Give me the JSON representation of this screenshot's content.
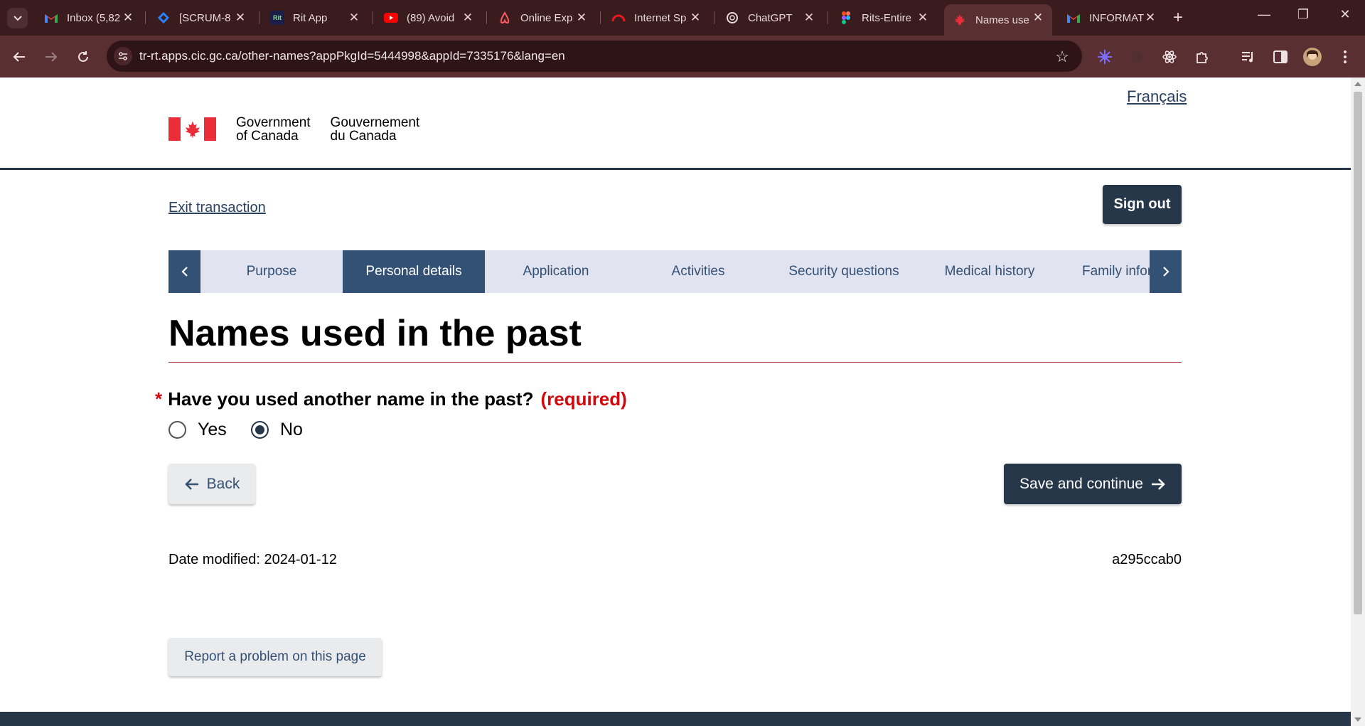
{
  "browser": {
    "tabs": [
      {
        "title": "Inbox (5,82",
        "icon": "gmail-icon"
      },
      {
        "title": "[SCRUM-8",
        "icon": "jira-icon"
      },
      {
        "title": "Rit App",
        "icon": "rit-app-icon",
        "icon_text": "Rit"
      },
      {
        "title": "(89) Avoid",
        "icon": "youtube-icon"
      },
      {
        "title": "Online Exp",
        "icon": "airbnb-icon"
      },
      {
        "title": "Internet Sp",
        "icon": "speedtest-icon"
      },
      {
        "title": "ChatGPT",
        "icon": "chatgpt-icon"
      },
      {
        "title": "Rits-Entire",
        "icon": "figma-icon"
      },
      {
        "title": "Names use",
        "icon": "maple-leaf-icon",
        "active": true
      },
      {
        "title": "INFORMAT",
        "icon": "gmail-icon"
      }
    ],
    "url": "tr-rt.apps.cic.gc.ca/other-names?appPkgId=5444998&appId=7335176&lang=en",
    "accent_color": "#5a2f32"
  },
  "header": {
    "language_link": "Français",
    "signature": {
      "en_line1": "Government",
      "en_line2": "of Canada",
      "fr_line1": "Gouvernement",
      "fr_line2": "du Canada"
    }
  },
  "nav": {
    "exit_link": "Exit transaction",
    "sign_out": "Sign out"
  },
  "steps": [
    {
      "label": "Purpose",
      "active": false
    },
    {
      "label": "Personal details",
      "active": true
    },
    {
      "label": "Application",
      "active": false
    },
    {
      "label": "Activities",
      "active": false
    },
    {
      "label": "Security questions",
      "active": false
    },
    {
      "label": "Medical history",
      "active": false
    },
    {
      "label": "Family infor",
      "active": false
    }
  ],
  "main": {
    "title": "Names used in the past",
    "question": {
      "marker": "*",
      "label": "Have you used another name in the past?",
      "required_text": "(required)",
      "options": [
        {
          "label": "Yes",
          "selected": false
        },
        {
          "label": "No",
          "selected": true
        }
      ]
    },
    "back_button": "Back",
    "save_button": "Save and continue"
  },
  "footer_info": {
    "date_modified": "Date modified: 2024-01-12",
    "build_id": "a295ccab0",
    "report_button": "Report a problem on this page"
  },
  "colors": {
    "primary": "#26374a",
    "link": "#284162",
    "required": "#d3080c",
    "flag_red": "#eb2d37"
  }
}
